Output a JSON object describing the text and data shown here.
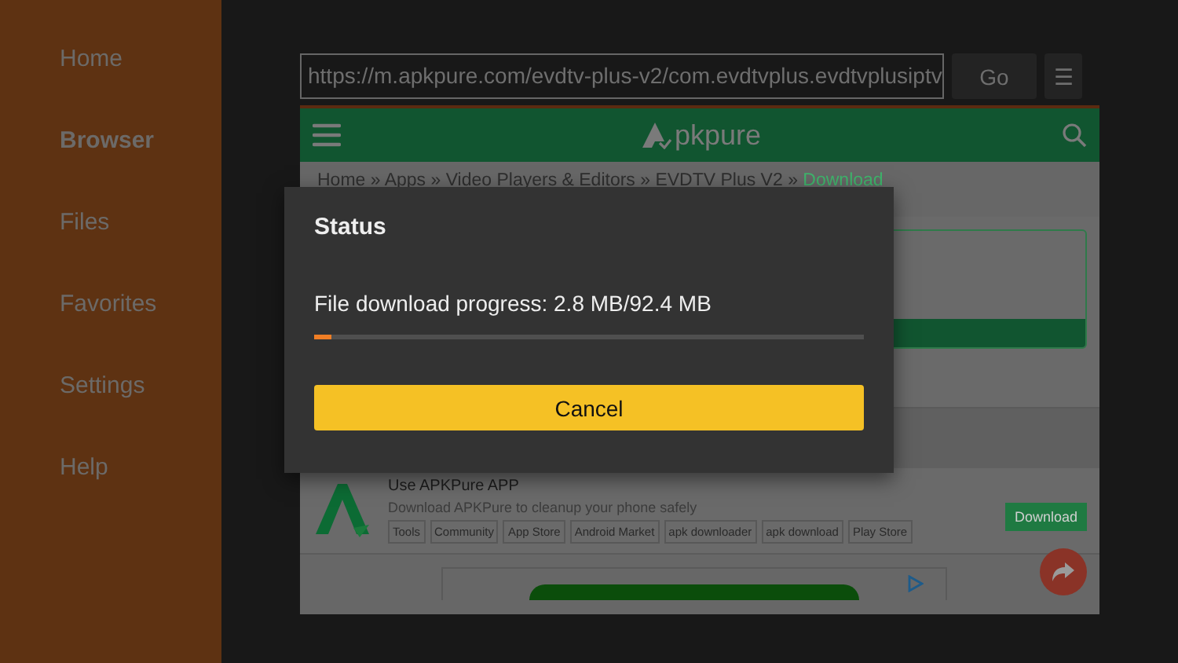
{
  "sidebar": {
    "items": [
      {
        "label": "Home",
        "selected": false
      },
      {
        "label": "Browser",
        "selected": true
      },
      {
        "label": "Files",
        "selected": false
      },
      {
        "label": "Favorites",
        "selected": false
      },
      {
        "label": "Settings",
        "selected": false
      },
      {
        "label": "Help",
        "selected": false
      }
    ]
  },
  "address_bar": {
    "value": "https://m.apkpure.com/evdtv-plus-v2/com.evdtvplus.evdtvplusiptv",
    "go": "Go",
    "menu": "☰"
  },
  "webpage": {
    "logo": "pkpure",
    "breadcrumb": "Home » Apps » Video Players & Editors » EVDTV Plus V2 » ",
    "breadcrumb_current": "Download",
    "promo": {
      "title": "Use APKPure APP",
      "subtitle": "Download APKPure to cleanup your phone safely",
      "tags": [
        "Tools",
        "Community",
        "App Store",
        "Android Market",
        "apk downloader",
        "apk download",
        "Play Store"
      ],
      "button": "Download"
    }
  },
  "dialog": {
    "title": "Status",
    "message": "File download progress: 2.8 MB/92.4 MB",
    "level": 0.03,
    "button": "Cancel"
  }
}
